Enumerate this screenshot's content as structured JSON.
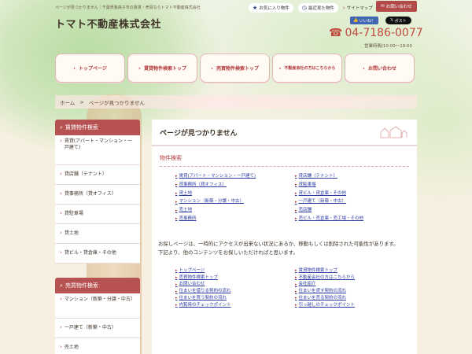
{
  "header": {
    "tagline": "ページが見つかりません｜千葉県我孫子市の賃貸・売買ならトマト不動産株式会社",
    "site_title": "トマト不動産株式会社",
    "util_links": [
      "お気に入り物件",
      "最近見た物件",
      "サイトマップ"
    ],
    "contact_mini": "お問い合わせ",
    "fb_label": "いいね！",
    "x_label": "ポスト",
    "phone": "04-7186-0077",
    "hours": "営業時間/10:00～18:00"
  },
  "nav": [
    "トップページ",
    "賃貸物件検索トップ",
    "売買物件検索トップ",
    "不動産会社の方はこちらから",
    "お問い合わせ"
  ],
  "breadcrumb": {
    "home": "ホーム",
    "sep": ">",
    "current": "ページが見つかりません"
  },
  "sidebar": {
    "rent_head": "賃貸物件検索",
    "rent_items": [
      "賃貸(アパート・マンション・一戸建て)",
      "貸店舗（テナント）",
      "貸事務所（貸オフィス）",
      "貸駐車場",
      "貸土地",
      "貸ビル・貸倉庫・その他"
    ],
    "sale_head": "売買物件検索",
    "sale_items": [
      "マンション（新築・分譲・中古）",
      "一戸建て（新築・中古）",
      "売土地"
    ]
  },
  "main": {
    "title": "ページが見つかりません",
    "section_title": "物件検索",
    "search_links": [
      "賃貸(アパート・マンション・一戸建て)",
      "貸店舗（テナント）",
      "貸事務所（貸オフィス）",
      "貸駐車場",
      "貸土地",
      "貸ビル・貸倉庫・その他",
      "マンション（新築・分譲・中古）",
      "一戸建て（新築・中古）",
      "売土地",
      "売店舗",
      "売事務所",
      "売ビル・売倉庫・売工場・その他"
    ],
    "message": [
      "お探しページは、一時的にアクセスが出来ない状況にあるか、移動もしくは削除された可能性があります。",
      "下記より、他のコンテンツをお探しいただければと思います。"
    ],
    "content_links": [
      "トップページ",
      "賃貸物件検索トップ",
      "売買物件検索トップ",
      "不動産会社の方はこちらから",
      "お問い合わせ",
      "会社紹介",
      "住まいを借りる契約の流れ",
      "住まいを貸す契約の流れ",
      "住まいを買う契約の流れ",
      "住まいを売る契約の流れ",
      "内覧時のチェックポイント",
      "引っ越しのチェックポイント"
    ]
  },
  "colors": {
    "accent": "#b65252",
    "link": "#2a3aa0",
    "phone": "#c04a3e"
  }
}
